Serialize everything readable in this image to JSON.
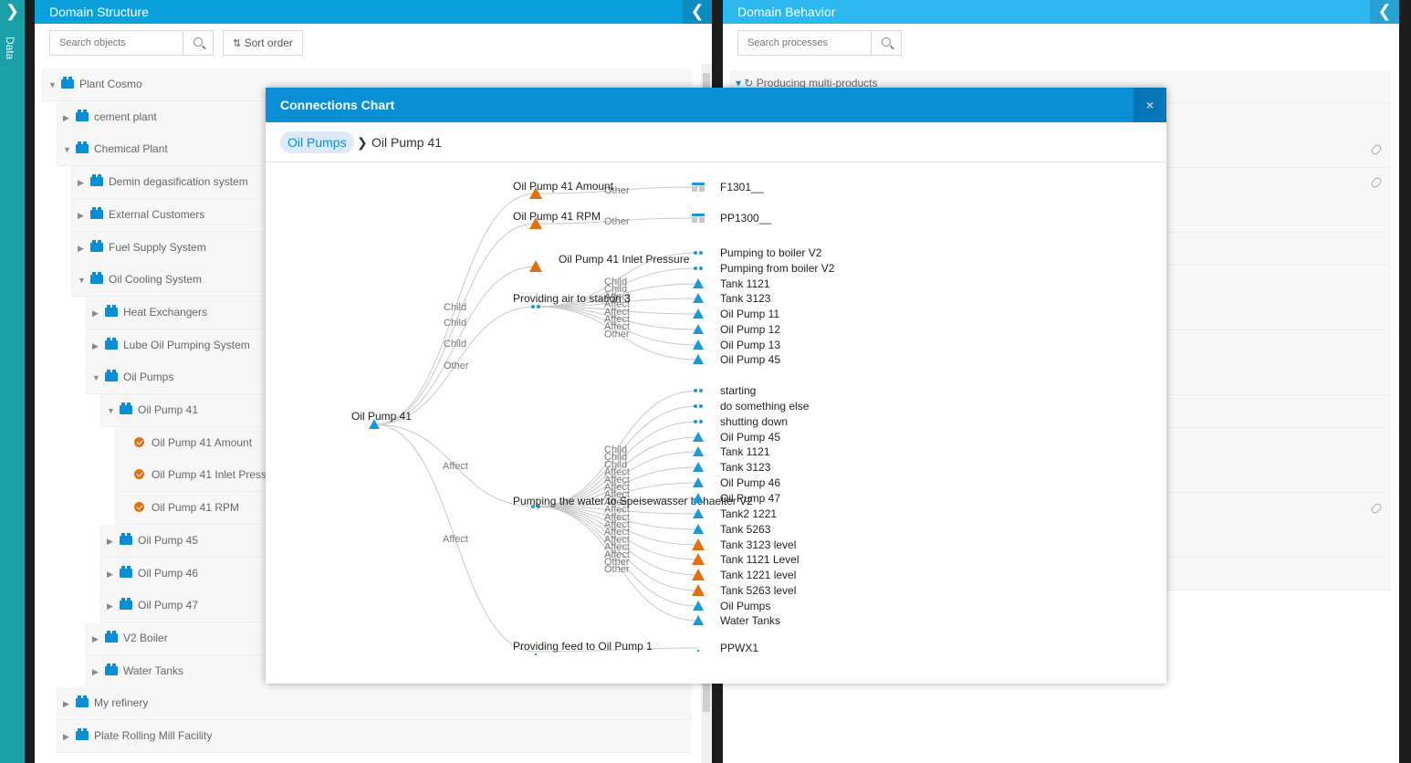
{
  "sidebar": {
    "toggle_icon": "chevron-right-icon",
    "label": "Data"
  },
  "left_panel": {
    "title": "Domain Structure",
    "search_placeholder": "Search objects",
    "sort_label": "Sort order",
    "tree": [
      {
        "label": "Plant Cosmo"
      },
      {
        "label": "cement plant"
      },
      {
        "label": "Chemical Plant"
      },
      {
        "label": "Demin degasification system"
      },
      {
        "label": "External Customers"
      },
      {
        "label": "Fuel Supply System"
      },
      {
        "label": "Oil Cooling System"
      },
      {
        "label": "Heat Exchangers"
      },
      {
        "label": "Lube Oil Pumping System"
      },
      {
        "label": "Oil Pumps"
      },
      {
        "label": "Oil Pump 41"
      },
      {
        "label": "Oil Pump 41 Amount"
      },
      {
        "label": "Oil Pump 41 Inlet Pressure"
      },
      {
        "label": "Oil Pump 41 RPM"
      },
      {
        "label": "Oil Pump 45"
      },
      {
        "label": "Oil Pump 46"
      },
      {
        "label": "Oil Pump 47"
      },
      {
        "label": "V2 Boiler"
      },
      {
        "label": "Water Tanks"
      },
      {
        "label": "My refinery"
      },
      {
        "label": "Plate Rolling Mill Facility"
      }
    ]
  },
  "right_panel": {
    "title": "Domain Behavior",
    "search_placeholder": "Search processes",
    "first_item": "Producing multi-products"
  },
  "modal": {
    "title": "Connections Chart",
    "close_label": "×",
    "crumb_parent": "Oil Pumps",
    "crumb_separator": "❯",
    "crumb_current": "Oil Pump 41",
    "root": "Oil Pump 41",
    "mid_nodes": [
      "Oil Pump 41 Amount",
      "Oil Pump 41 RPM",
      "Oil Pump 41 Inlet Pressure",
      "Providing air to station 3",
      "Pumping the water to Speisewasser behaelter V2",
      "Providing feed to Oil Pump 1"
    ],
    "root_edge_labels": [
      "Child",
      "Child",
      "Child",
      "Other",
      "Affect",
      "Affect"
    ],
    "leaf_edge_labels_top": [
      "Other",
      "Other",
      "Child",
      "Child",
      "Affect",
      "Affect",
      "Affect",
      "Affect",
      "Affect",
      "Other"
    ],
    "leaf_edge_labels_bottom": [
      "Child",
      "Child",
      "Child",
      "Affect",
      "Affect",
      "Affect",
      "Affect",
      "Affect",
      "Affect",
      "Affect",
      "Affect",
      "Affect",
      "Affect",
      "Affect",
      "Affect",
      "Other",
      "Other"
    ],
    "leaves": [
      {
        "label": "F1301__",
        "shape": "table"
      },
      {
        "label": "PP1300__",
        "shape": "table"
      },
      {
        "label": "Pumping to boiler V2",
        "shape": "process"
      },
      {
        "label": "Pumping from boiler V2",
        "shape": "process"
      },
      {
        "label": "Tank 1121",
        "shape": "object"
      },
      {
        "label": "Tank 3123",
        "shape": "object"
      },
      {
        "label": "Oil Pump 11",
        "shape": "object"
      },
      {
        "label": "Oil Pump 12",
        "shape": "object"
      },
      {
        "label": "Oil Pump 13",
        "shape": "object"
      },
      {
        "label": "Oil Pump 45",
        "shape": "object"
      },
      {
        "label": "starting",
        "shape": "process"
      },
      {
        "label": "do something else",
        "shape": "process"
      },
      {
        "label": "shutting down",
        "shape": "process"
      },
      {
        "label": "Oil Pump 45",
        "shape": "object"
      },
      {
        "label": "Tank 1121",
        "shape": "object"
      },
      {
        "label": "Tank 3123",
        "shape": "object"
      },
      {
        "label": "Oil Pump 46",
        "shape": "object"
      },
      {
        "label": "Oil Pump 47",
        "shape": "object"
      },
      {
        "label": "Tank2 1221",
        "shape": "object"
      },
      {
        "label": "Tank 5263",
        "shape": "object"
      },
      {
        "label": "Tank 3123 level",
        "shape": "tag"
      },
      {
        "label": "Tank 1121 Level",
        "shape": "tag"
      },
      {
        "label": "Tank 1221 level",
        "shape": "tag"
      },
      {
        "label": "Tank 5263 level",
        "shape": "tag"
      },
      {
        "label": "Oil Pumps",
        "shape": "object"
      },
      {
        "label": "Water Tanks",
        "shape": "object"
      },
      {
        "label": "PPWX1",
        "shape": "dot"
      }
    ]
  },
  "colors": {
    "header": "#0aa0dc",
    "object": "#1a9ad6",
    "tag": "#e07010",
    "accent_strip": "#1a9fa6"
  }
}
